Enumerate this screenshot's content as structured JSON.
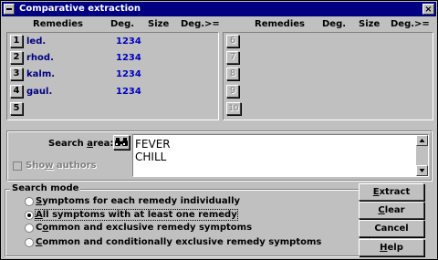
{
  "window": {
    "title": "Comparative extraction",
    "close_glyph": "×"
  },
  "columns": {
    "left": {
      "remedies": "Remedies",
      "deg": "Deg.",
      "size": "Size",
      "deggte": "Deg.>="
    },
    "right": {
      "remedies": "Remedies",
      "deg": "Deg.",
      "size": "Size",
      "deggte": "Deg.>="
    }
  },
  "left_rows": [
    {
      "num": "1",
      "name": "led.",
      "deg": "1234"
    },
    {
      "num": "2",
      "name": "rhod.",
      "deg": "1234"
    },
    {
      "num": "3",
      "name": "kalm.",
      "deg": "1234"
    },
    {
      "num": "4",
      "name": "gaul.",
      "deg": "1234"
    },
    {
      "num": "5",
      "name": "",
      "deg": ""
    }
  ],
  "right_rows": [
    {
      "num": "6"
    },
    {
      "num": "7"
    },
    {
      "num": "8"
    },
    {
      "num": "9"
    },
    {
      "num": "10"
    }
  ],
  "search": {
    "label_pre": "Search ",
    "label_ul": "a",
    "label_post": "rea:",
    "binoculars_icon": "binoculars-icon",
    "lines": [
      "FEVER",
      "CHILL"
    ],
    "show_authors_pre": "Sho",
    "show_authors_ul": "w",
    "show_authors_post": " authors"
  },
  "search_mode": {
    "title": "Search mode",
    "options": [
      {
        "pre": "",
        "ul": "S",
        "post": "ymptoms for each remedy individually",
        "selected": false
      },
      {
        "pre": "",
        "ul": "A",
        "post": "ll symptoms with at least one remedy",
        "selected": true
      },
      {
        "pre": "C",
        "ul": "o",
        "post": "mmon and exclusive remedy symptoms",
        "selected": false
      },
      {
        "pre": "",
        "ul": "C",
        "post": "ommon and conditionally exclusive remedy symptoms",
        "selected": false
      }
    ]
  },
  "buttons": {
    "extract": {
      "ul": "E",
      "rest": "xtract"
    },
    "clear": {
      "ul": "C",
      "rest": "lear"
    },
    "cancel": {
      "ul": "",
      "rest": "Cancel"
    },
    "help": {
      "ul": "H",
      "rest": "elp"
    }
  }
}
